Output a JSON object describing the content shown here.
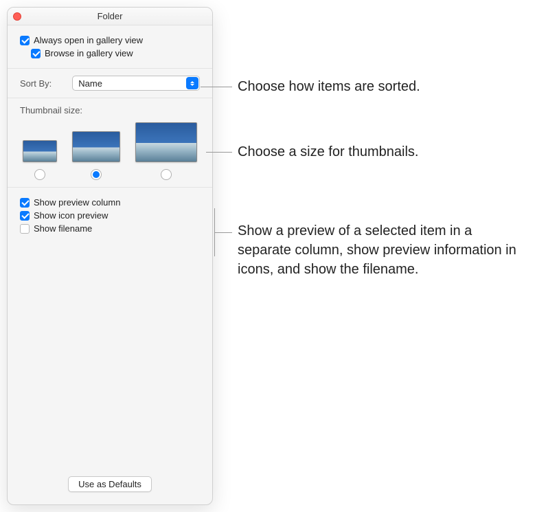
{
  "window": {
    "title": "Folder"
  },
  "view_options": {
    "always_open_label": "Always open in gallery view",
    "always_open_checked": true,
    "browse_label": "Browse in gallery view",
    "browse_checked": true
  },
  "sort": {
    "label": "Sort By:",
    "value": "Name"
  },
  "thumbnail": {
    "label": "Thumbnail size:",
    "selected_index": 1
  },
  "preview_options": {
    "show_preview_label": "Show preview column",
    "show_preview_checked": true,
    "show_icon_preview_label": "Show icon preview",
    "show_icon_preview_checked": true,
    "show_filename_label": "Show filename",
    "show_filename_checked": false
  },
  "footer": {
    "defaults_button": "Use as Defaults"
  },
  "annotations": {
    "sort": "Choose how items are sorted.",
    "thumb": "Choose a size for thumbnails.",
    "preview": "Show a preview of a selected item in a separate column, show preview information in icons, and show the filename."
  }
}
